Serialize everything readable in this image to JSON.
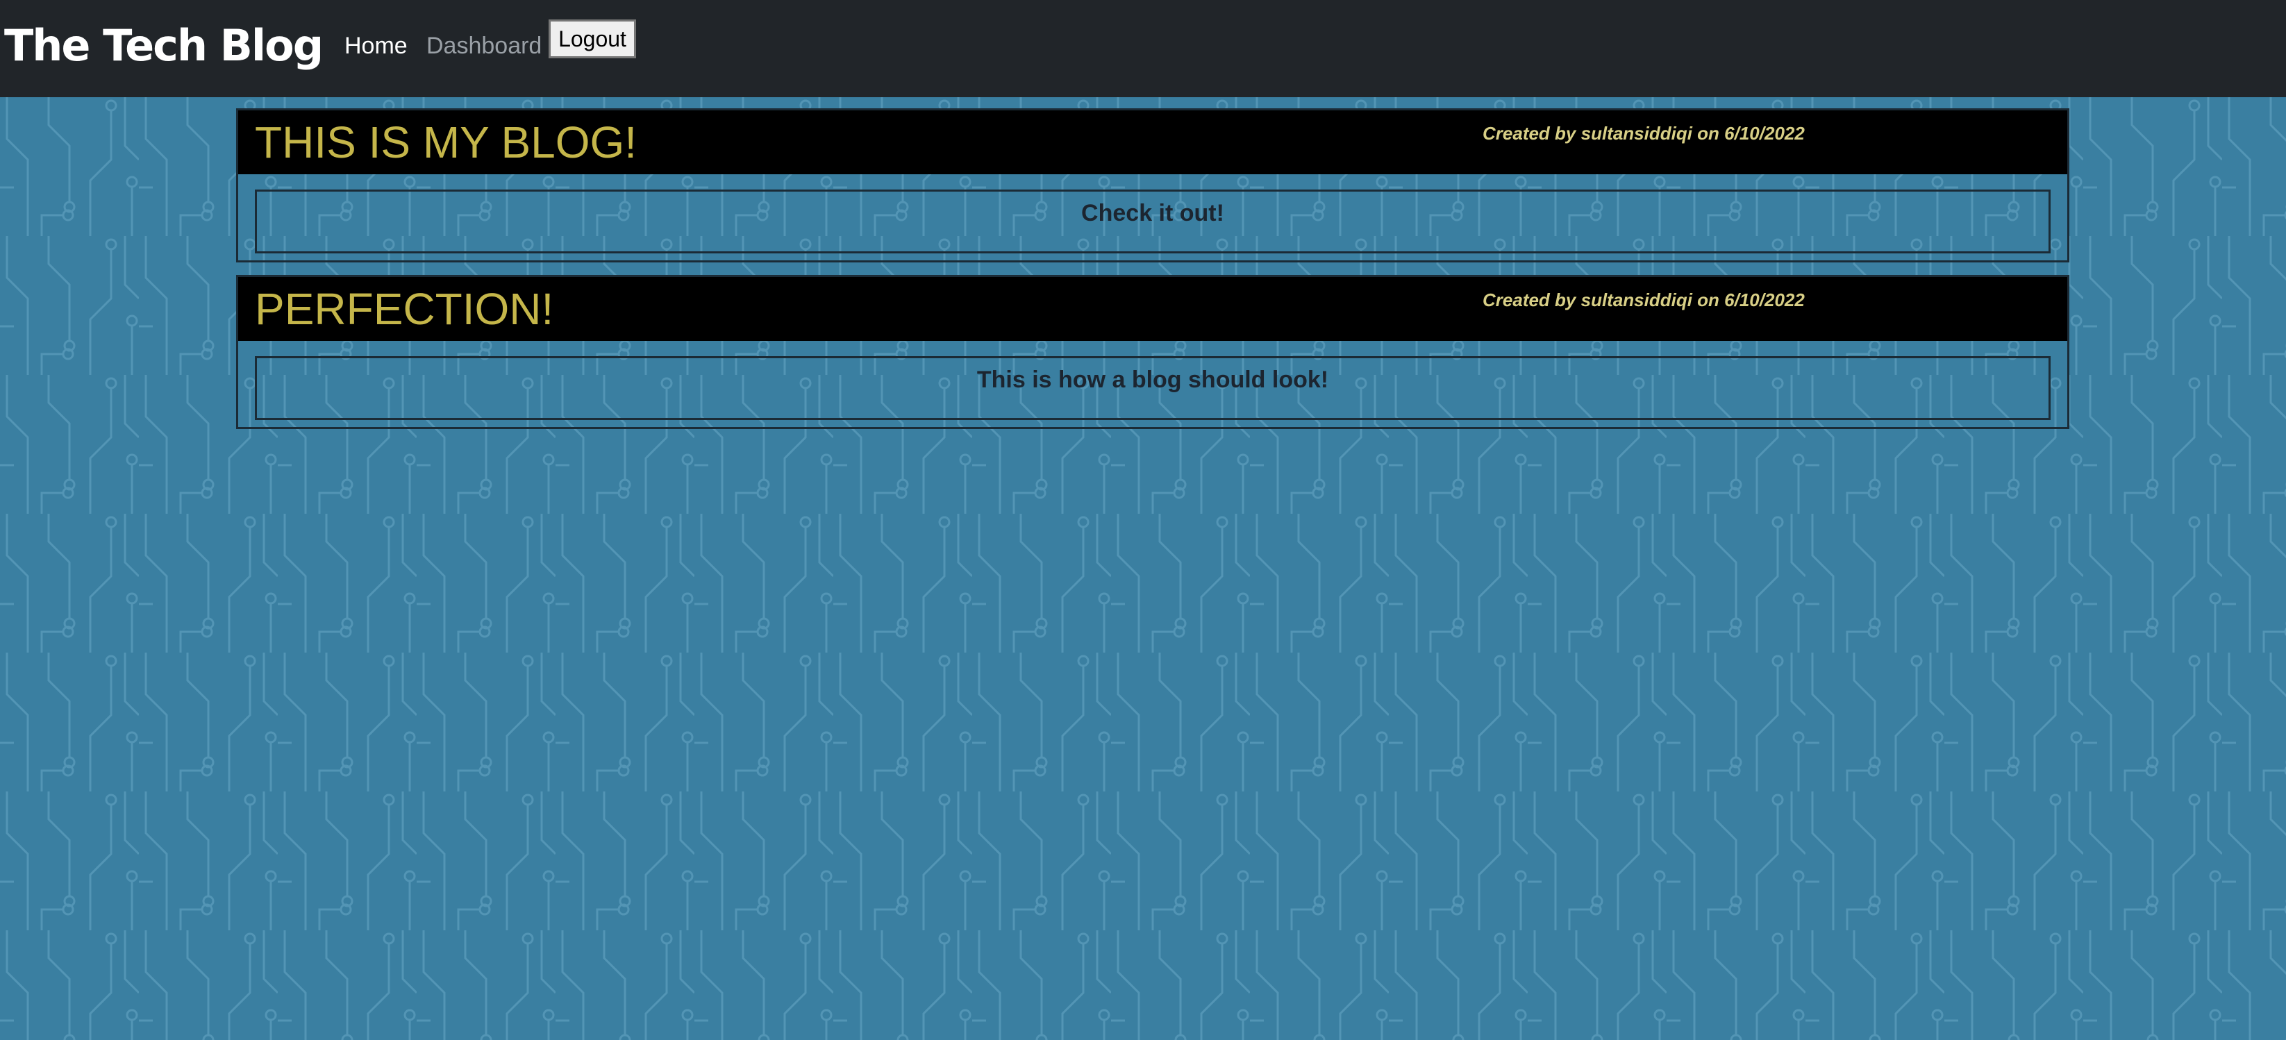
{
  "colors": {
    "navbar_bg": "#212529",
    "page_bg": "#3a7fa1",
    "title_color": "#c5b64a",
    "meta_color": "#d8cf86"
  },
  "navbar": {
    "brand": "The Tech Blog",
    "links": [
      {
        "label": "Home",
        "active": true
      },
      {
        "label": "Dashboard",
        "active": false
      }
    ],
    "logout_label": "Logout"
  },
  "posts": [
    {
      "title": "THIS IS MY BLOG!",
      "meta": "Created by sultansiddiqi on 6/10/2022",
      "content": "Check it out!"
    },
    {
      "title": "PERFECTION!",
      "meta": "Created by sultansiddiqi on 6/10/2022",
      "content": "This is how a blog should look!"
    }
  ]
}
